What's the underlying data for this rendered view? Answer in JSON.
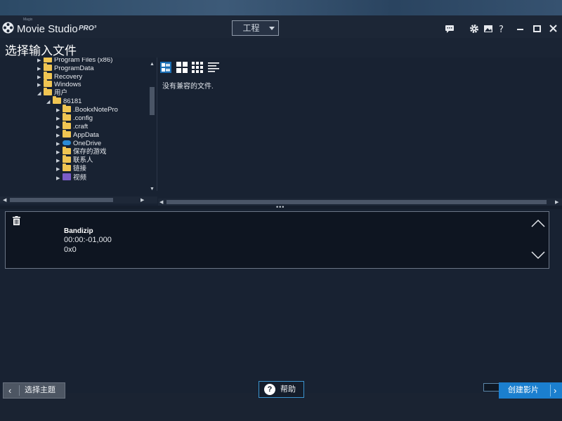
{
  "app": {
    "name": "Movie Studio",
    "edition": "PRO³",
    "tiny_label": "Magix",
    "project_menu": "工程"
  },
  "page_title": "选择输入文件",
  "tree": {
    "items": [
      {
        "label": "Program Files (x86)",
        "expanded": false
      },
      {
        "label": "ProgramData",
        "expanded": false
      },
      {
        "label": "Recovery",
        "expanded": false
      },
      {
        "label": "Windows",
        "expanded": false
      },
      {
        "label": "用户",
        "expanded": true
      },
      {
        "label": "86181",
        "expanded": true
      },
      {
        "label": ".BookxNotePro",
        "expanded": false
      },
      {
        "label": ".config",
        "expanded": false
      },
      {
        "label": ".craft",
        "expanded": false
      },
      {
        "label": "AppData",
        "expanded": false
      },
      {
        "label": "OneDrive",
        "expanded": false,
        "icon": "cloud-icon"
      },
      {
        "label": "保存的游戏",
        "expanded": false
      },
      {
        "label": "联系人",
        "expanded": false
      },
      {
        "label": "链接",
        "expanded": false
      },
      {
        "label": "视频",
        "expanded": false,
        "icon": "video-folder-icon"
      }
    ]
  },
  "file_view": {
    "empty_message": "没有兼容的文件.",
    "view_modes": [
      "details-view-icon",
      "large-grid-icon",
      "small-grid-icon",
      "list-view-icon"
    ]
  },
  "media_item": {
    "name": "Bandizip",
    "duration": "00:00:-01,000",
    "dimensions": "0x0"
  },
  "buttons": {
    "back_label": "选择主题",
    "help_label": "帮助",
    "create_label": "创建影片"
  },
  "colors": {
    "accent": "#1b7fcf",
    "folder": "#f0c552",
    "background": "#182232"
  }
}
